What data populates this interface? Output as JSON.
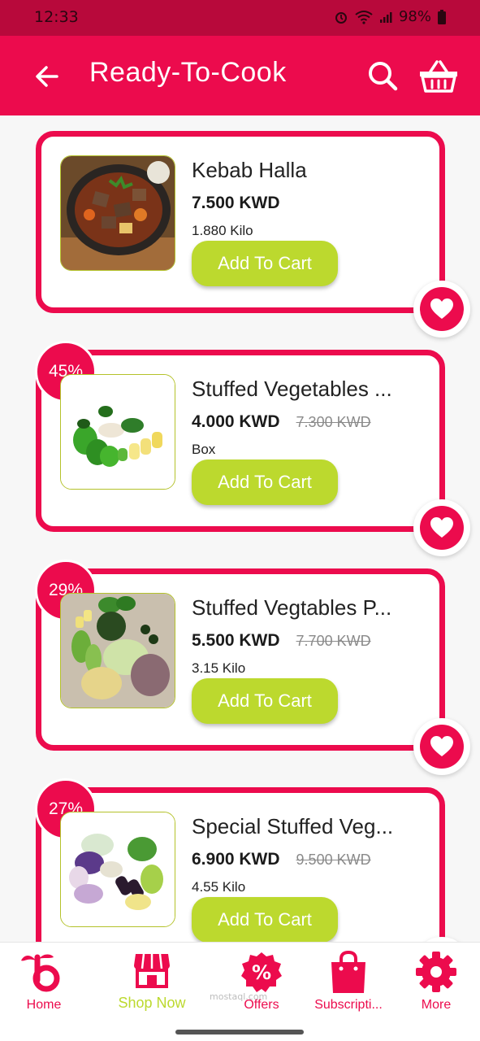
{
  "status_bar": {
    "time": "12:33",
    "battery": "98%"
  },
  "app_bar": {
    "title": "Ready-To-Cook"
  },
  "products": [
    {
      "name": "Kebab Halla",
      "price": "7.500 KWD",
      "old_price": "",
      "unit": "1.880  Kilo",
      "discount": "",
      "cart_label": "Add To Cart"
    },
    {
      "name": "Stuffed Vegetables ...",
      "price": "4.000 KWD",
      "old_price": "7.300 KWD",
      "unit": "Box",
      "discount": "45%",
      "cart_label": "Add To Cart"
    },
    {
      "name": "Stuffed Vegtables P...",
      "price": "5.500 KWD",
      "old_price": "7.700 KWD",
      "unit": "3.15 Kilo",
      "discount": "29%",
      "cart_label": "Add To Cart"
    },
    {
      "name": "Special Stuffed Veg...",
      "price": "6.900 KWD",
      "old_price": "9.500 KWD",
      "unit": "4.55 Kilo",
      "discount": "27%",
      "cart_label": "Add To Cart"
    }
  ],
  "bottom_nav": {
    "home": "Home",
    "shop_now": "Shop Now",
    "offers": "Offers",
    "subscriptions": "Subscripti...",
    "more": "More"
  },
  "watermark": "mostaql.com",
  "colors": {
    "primary": "#ec0b4d",
    "accent": "#bcd92e",
    "status_bar": "#b8093b"
  }
}
